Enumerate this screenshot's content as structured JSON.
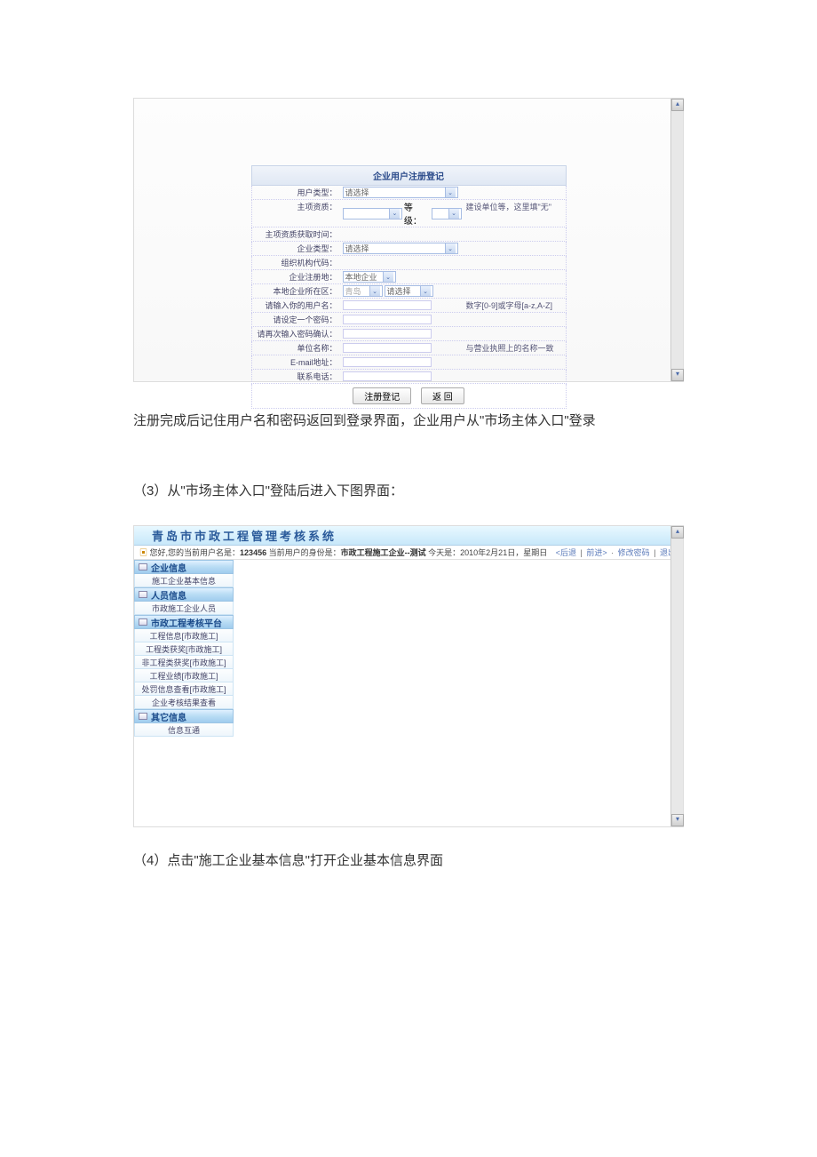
{
  "screenshot1": {
    "form_title": "企业用户注册登记",
    "rows": {
      "user_type": {
        "label": "用户类型：",
        "value": "请选择"
      },
      "main_qual": {
        "label": "主项资质：",
        "level_label": "等级：",
        "hint": "建设单位等，这里填\"无\""
      },
      "qual_time": {
        "label": "主项资质获取时间："
      },
      "ent_type": {
        "label": "企业类型：",
        "value": "请选择"
      },
      "org_code": {
        "label": "组织机构代码："
      },
      "reg_loc": {
        "label": "企业注册地：",
        "value": "本地企业"
      },
      "local_area": {
        "label": "本地企业所在区：",
        "city": "青岛",
        "dist": "请选择"
      },
      "username": {
        "label": "请输入你的用户名：",
        "hint": "数字[0-9]或字母[a-z,A-Z]"
      },
      "password": {
        "label": "请设定一个密码："
      },
      "confirm": {
        "label": "请再次输入密码确认："
      },
      "unit_name": {
        "label": "单位名称：",
        "hint": "与营业执照上的名称一致"
      },
      "email": {
        "label": "E-mail地址："
      },
      "phone": {
        "label": "联系电话："
      }
    },
    "buttons": {
      "register": "注册登记",
      "back": "返 回"
    }
  },
  "prose": {
    "p1": "注册完成后记住用户名和密码返回到登录界面，企业用户从\"市场主体入口\"登录",
    "p2": "（3）从\"市场主体入口\"登陆后进入下图界面：",
    "p3": "（4）点击\"施工企业基本信息\"打开企业基本信息界面"
  },
  "screenshot2": {
    "title": "青岛市市政工程管理考核系统",
    "info_left_pre": "您好,您的当前用户名是：",
    "info_user": "123456",
    "info_role_pre": " 当前用户的身份是：",
    "info_role": "市政工程施工企业--测试",
    "info_date_pre": " 今天是：",
    "info_date": "2010年2月21日，星期日",
    "links": {
      "back": "<后退",
      "fwd": "前进>",
      "pwd": "修改密码",
      "exit": "退出"
    },
    "sidebar": {
      "s1": {
        "title": "企业信息",
        "items": [
          "施工企业基本信息"
        ]
      },
      "s2": {
        "title": "人员信息",
        "items": [
          "市政施工企业人员"
        ]
      },
      "s3": {
        "title": "市政工程考核平台",
        "items": [
          "工程信息[市政施工]",
          "工程类获奖[市政施工]",
          "非工程类获奖[市政施工]",
          "工程业绩[市政施工]",
          "处罚信息查看[市政施工]",
          "企业考核结果查看"
        ]
      },
      "s4": {
        "title": "其它信息",
        "items": [
          "信息互通"
        ]
      }
    }
  }
}
